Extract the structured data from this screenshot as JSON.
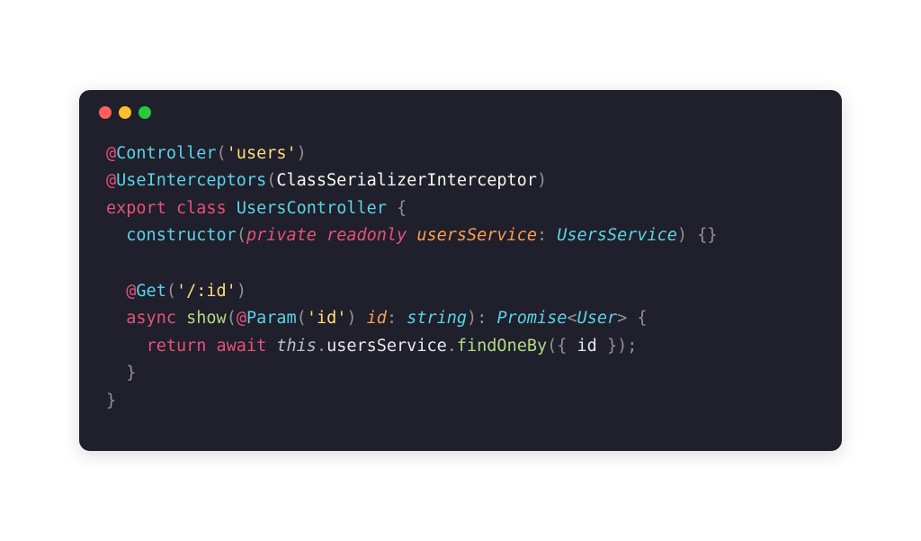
{
  "window": {
    "controls": {
      "red": "close",
      "yellow": "minimize",
      "green": "maximize"
    }
  },
  "code": {
    "line1": {
      "at": "@",
      "decorator": "Controller",
      "lparen": "(",
      "str": "'users'",
      "rparen": ")"
    },
    "line2": {
      "at": "@",
      "decorator": "UseInterceptors",
      "lparen": "(",
      "arg": "ClassSerializerInterceptor",
      "rparen": ")"
    },
    "line3": {
      "export": "export",
      "class": "class",
      "name": "UsersController",
      "lbrace": "{"
    },
    "line4": {
      "indent": "  ",
      "ctor": "constructor",
      "lparen": "(",
      "private": "private",
      "readonly": "readonly",
      "param": "usersService",
      "colon": ":",
      "type": "UsersService",
      "rparen": ")",
      "empty": "{}"
    },
    "line6": {
      "indent": "  ",
      "at": "@",
      "decorator": "Get",
      "lparen": "(",
      "str": "'/:id'",
      "rparen": ")"
    },
    "line7": {
      "indent": "  ",
      "async": "async",
      "method": "show",
      "lparen": "(",
      "at": "@",
      "decorator": "Param",
      "dlparen": "(",
      "dstr": "'id'",
      "drparen": ")",
      "param": "id",
      "colon1": ":",
      "ptype": "string",
      "rparen": ")",
      "colon2": ":",
      "promise": "Promise",
      "langle": "<",
      "gtype": "User",
      "rangle": ">",
      "lbrace": "{"
    },
    "line8": {
      "indent": "    ",
      "return": "return",
      "await": "await",
      "this": "this",
      "dot1": ".",
      "svc": "usersService",
      "dot2": ".",
      "method": "findOneBy",
      "lparen": "(",
      "lbrace": "{",
      "prop": "id",
      "rbrace": "}",
      "rparen": ")",
      "semi": ";"
    },
    "line9": {
      "indent": "  ",
      "rbrace": "}"
    },
    "line10": {
      "rbrace": "}"
    }
  }
}
